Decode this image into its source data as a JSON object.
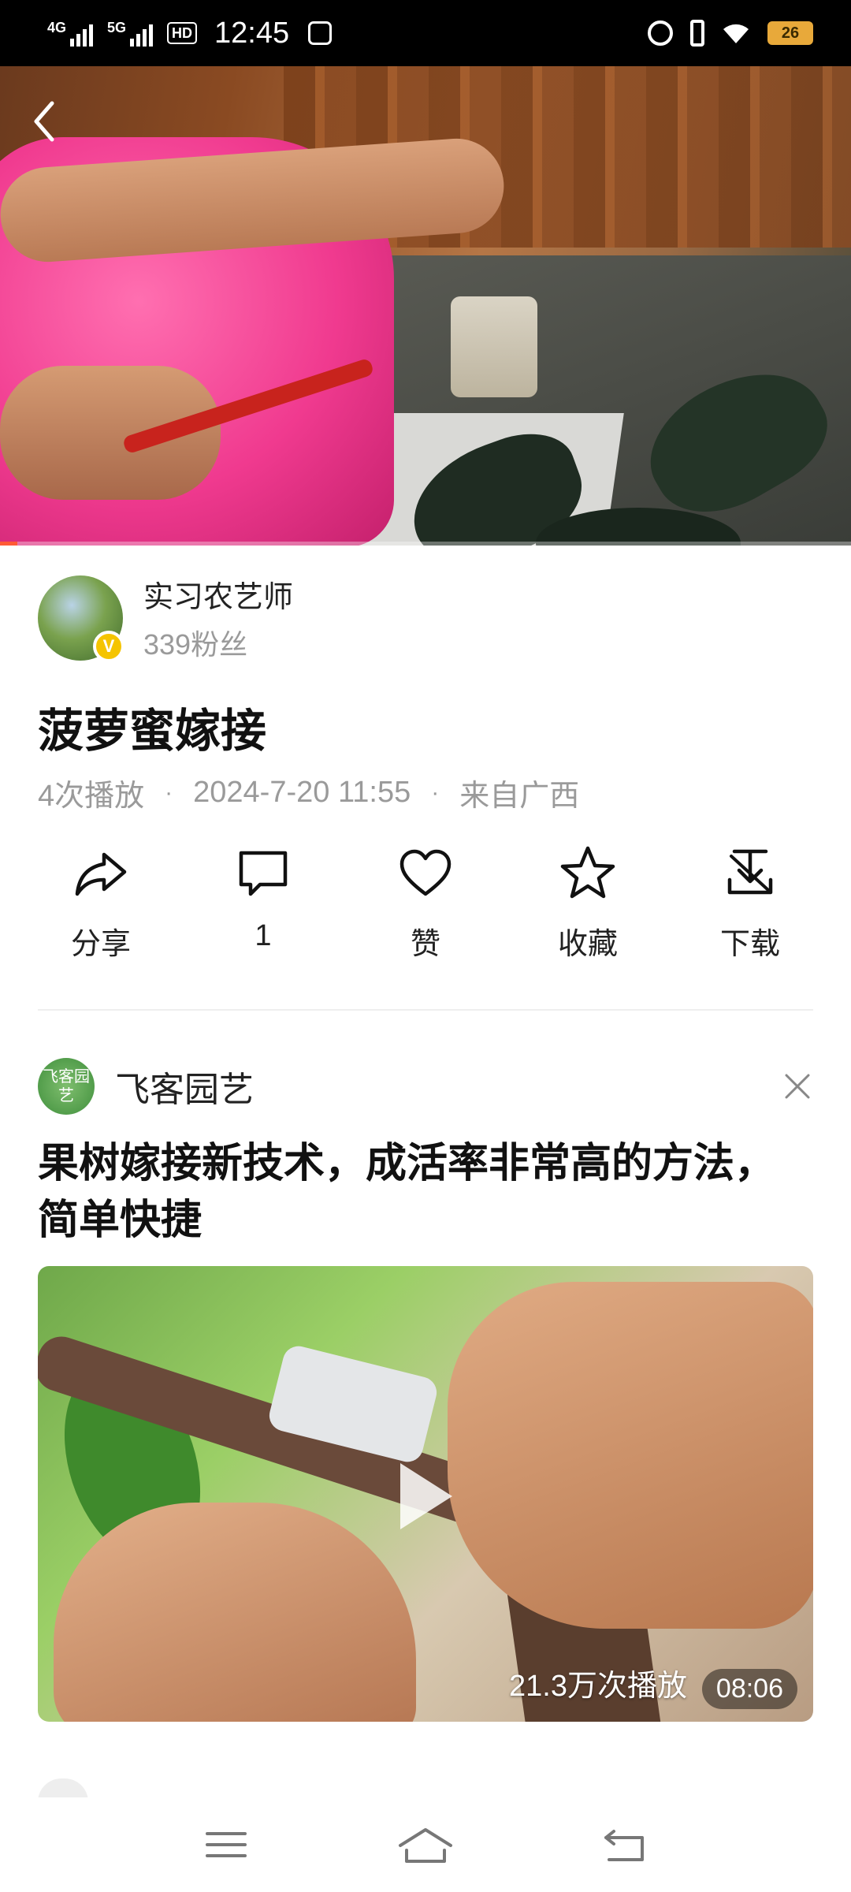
{
  "status_bar": {
    "network1": "4G",
    "network2": "5G",
    "hd": "HD",
    "time": "12:45",
    "battery": "26"
  },
  "video": {
    "progress_fraction": 0.02
  },
  "author": {
    "name": "实习农艺师",
    "fans": "339粉丝",
    "badge": "V"
  },
  "post": {
    "title": "菠萝蜜嫁接",
    "plays": "4次播放",
    "datetime": "2024-7-20 11:55",
    "location": "来自广西",
    "sep": "·"
  },
  "actions": [
    {
      "label": "分享",
      "icon": "share-icon"
    },
    {
      "label": "1",
      "icon": "comment-icon"
    },
    {
      "label": "赞",
      "icon": "heart-icon"
    },
    {
      "label": "收藏",
      "icon": "star-icon"
    },
    {
      "label": "下载",
      "icon": "download-icon"
    }
  ],
  "recommendation": {
    "channel_avatar_text": "飞客园艺",
    "channel_name": "飞客园艺",
    "title": "果树嫁接新技术，成活率非常高的方法，简单快捷",
    "play_count": "21.3万次播放",
    "duration": "08:06"
  },
  "colors": {
    "accent": "#ff5a36",
    "verified": "#f5c400"
  }
}
